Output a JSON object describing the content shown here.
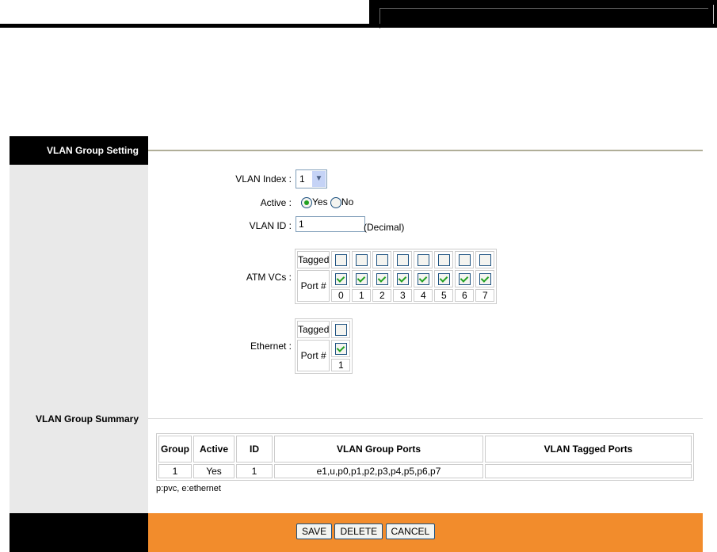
{
  "sidebar": {
    "setting_title": "VLAN Group Setting",
    "summary_title": "VLAN Group Summary"
  },
  "form": {
    "vlan_index_label": "VLAN Index :",
    "vlan_index_value": "1",
    "active_label": "Active :",
    "yes_label": "Yes",
    "no_label": "No",
    "active_value": "Yes",
    "vlan_id_label": "VLAN ID :",
    "vlan_id_value": "1",
    "vlan_id_hint": "(Decimal)",
    "atm_label": "ATM VCs :",
    "tagged_label": "Tagged",
    "port_label": "Port #",
    "atm_ports": [
      "0",
      "1",
      "2",
      "3",
      "4",
      "5",
      "6",
      "7"
    ],
    "atm_tagged": [
      false,
      false,
      false,
      false,
      false,
      false,
      false,
      false
    ],
    "atm_member": [
      true,
      true,
      true,
      true,
      true,
      true,
      true,
      true
    ],
    "eth_label": "Ethernet :",
    "eth_ports": [
      "1"
    ],
    "eth_tagged": [
      false
    ],
    "eth_member": [
      true
    ]
  },
  "summary": {
    "headers": [
      "Group",
      "Active",
      "ID",
      "VLAN Group Ports",
      "VLAN Tagged Ports"
    ],
    "rows": [
      [
        "1",
        "Yes",
        "1",
        "e1,u,p0,p1,p2,p3,p4,p5,p6,p7",
        ""
      ]
    ],
    "legend": "p:pvc, e:ethernet"
  },
  "buttons": {
    "save": "SAVE",
    "delete": "DELETE",
    "cancel": "CANCEL"
  }
}
